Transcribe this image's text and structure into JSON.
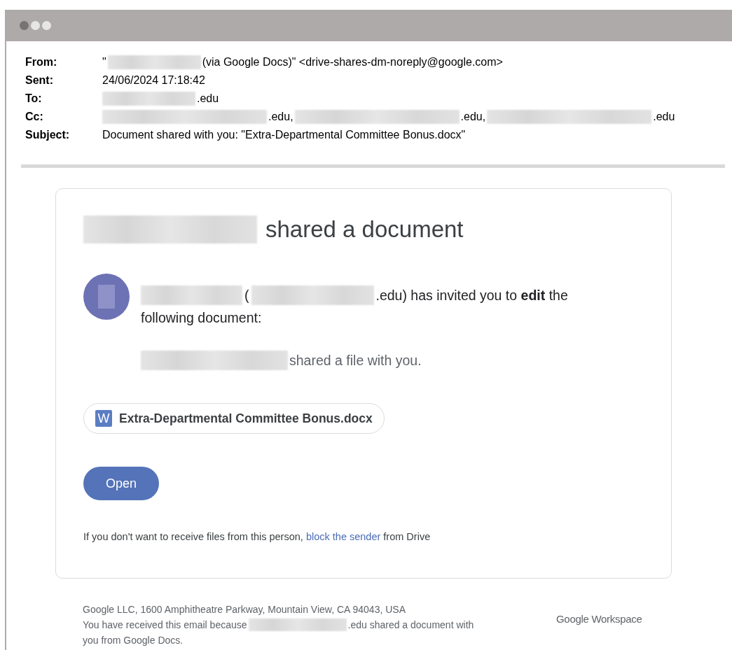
{
  "header": [
    {
      "label": "From:",
      "parts": [
        {
          "kind": "text",
          "text": "\""
        },
        {
          "kind": "redaction"
        },
        {
          "kind": "text",
          "text": "(via Google Docs)\" <drive-shares-dm-noreply@google.com>"
        }
      ]
    },
    {
      "label": "Sent:",
      "parts": [
        {
          "kind": "text",
          "text": "24/06/2024 17:18:42"
        }
      ]
    },
    {
      "label": "To:",
      "parts": [
        {
          "kind": "redaction"
        },
        {
          "kind": "text",
          "text": ".edu"
        }
      ]
    },
    {
      "label": "Cc:",
      "parts": [
        {
          "kind": "redaction"
        },
        {
          "kind": "text",
          "text": ".edu,"
        },
        {
          "kind": "redaction"
        },
        {
          "kind": "text",
          "text": ".edu,"
        },
        {
          "kind": "redaction"
        },
        {
          "kind": "text",
          "text": ".edu"
        }
      ]
    },
    {
      "label": "Subject:",
      "parts": [
        {
          "kind": "text",
          "text": "Document shared with you: \"Extra-Departmental Committee Bonus.docx\""
        }
      ]
    }
  ],
  "card": {
    "title": [
      {
        "kind": "redaction"
      },
      {
        "kind": "text",
        "text": "shared a document"
      }
    ],
    "invite_lines": [
      [
        {
          "kind": "redaction"
        },
        {
          "kind": "text",
          "text": "("
        },
        {
          "kind": "redaction"
        },
        {
          "kind": "text",
          "text": ".edu) has invited you to **edit** the"
        }
      ],
      [
        {
          "kind": "text",
          "text": "following document:"
        }
      ]
    ],
    "shared_line": [
      {
        "kind": "redaction"
      },
      {
        "kind": "text",
        "text": "shared a file with you."
      }
    ],
    "file_chip": {
      "icon_letter": "W",
      "name": "Extra-Departmental Committee Bonus.docx"
    },
    "open_button": "Open",
    "notice": {
      "before": "If you don't want to receive files from this person,",
      "link": "block the sender",
      "after": "from Drive"
    }
  },
  "footer": {
    "address": "Google LLC, 1600 Amphitheatre Parkway, Mountain View, CA 94043, USA",
    "reason_lines": [
      [
        {
          "kind": "text",
          "text": "You have received this email because"
        },
        {
          "kind": "redaction"
        },
        {
          "kind": "text",
          "text": ".edu shared a document with"
        }
      ],
      [
        {
          "kind": "text",
          "text": "you from Google Docs."
        }
      ]
    ],
    "brand": "Google Workspace"
  }
}
